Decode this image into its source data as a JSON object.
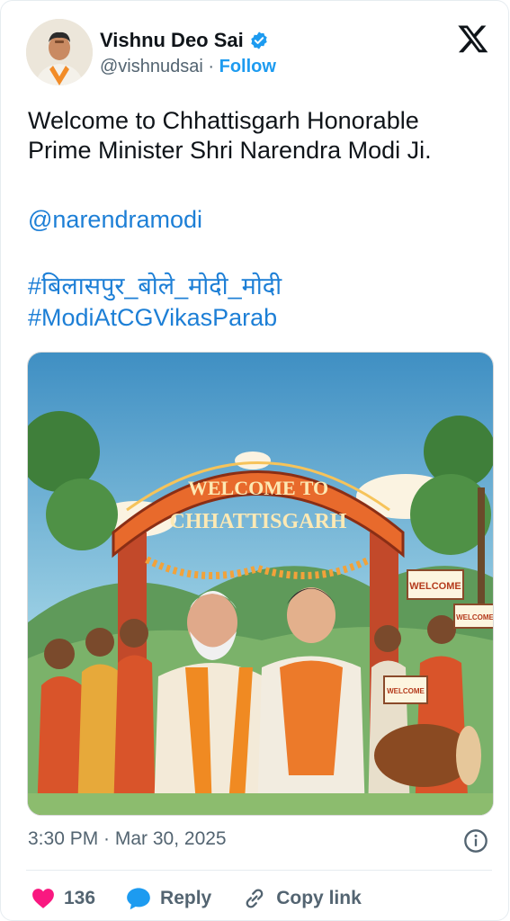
{
  "author": {
    "name": "Vishnu Deo Sai",
    "handle": "@vishnudsai",
    "separator": "·",
    "follow_label": "Follow"
  },
  "post": {
    "line1": "Welcome to Chhattisgarh Honorable",
    "line2": "Prime Minister Shri Narendra Modi Ji.",
    "mention": "@narendramodi",
    "hashtag1": "#बिलासपुर_बोले_मोदी_मोदी",
    "hashtag2": "#ModiAtCGVikasParab"
  },
  "media": {
    "arch_line1": "WELCOME TO",
    "arch_line2": "CHHATTISGARH",
    "sign1": "WELCOME",
    "sign2": "WELCOME",
    "sign3": "WELCOME"
  },
  "meta": {
    "timestamp": "3:30 PM · Mar 30, 2025"
  },
  "actions": {
    "like_count": "136",
    "reply_label": "Reply",
    "copy_label": "Copy link"
  },
  "colors": {
    "accent": "#1d9bf0",
    "like": "#f91880",
    "text": "#0f1419",
    "muted": "#536471"
  },
  "icons": [
    "verified-badge-icon",
    "x-logo-icon",
    "info-icon",
    "heart-icon",
    "reply-bubble-icon",
    "link-icon"
  ]
}
